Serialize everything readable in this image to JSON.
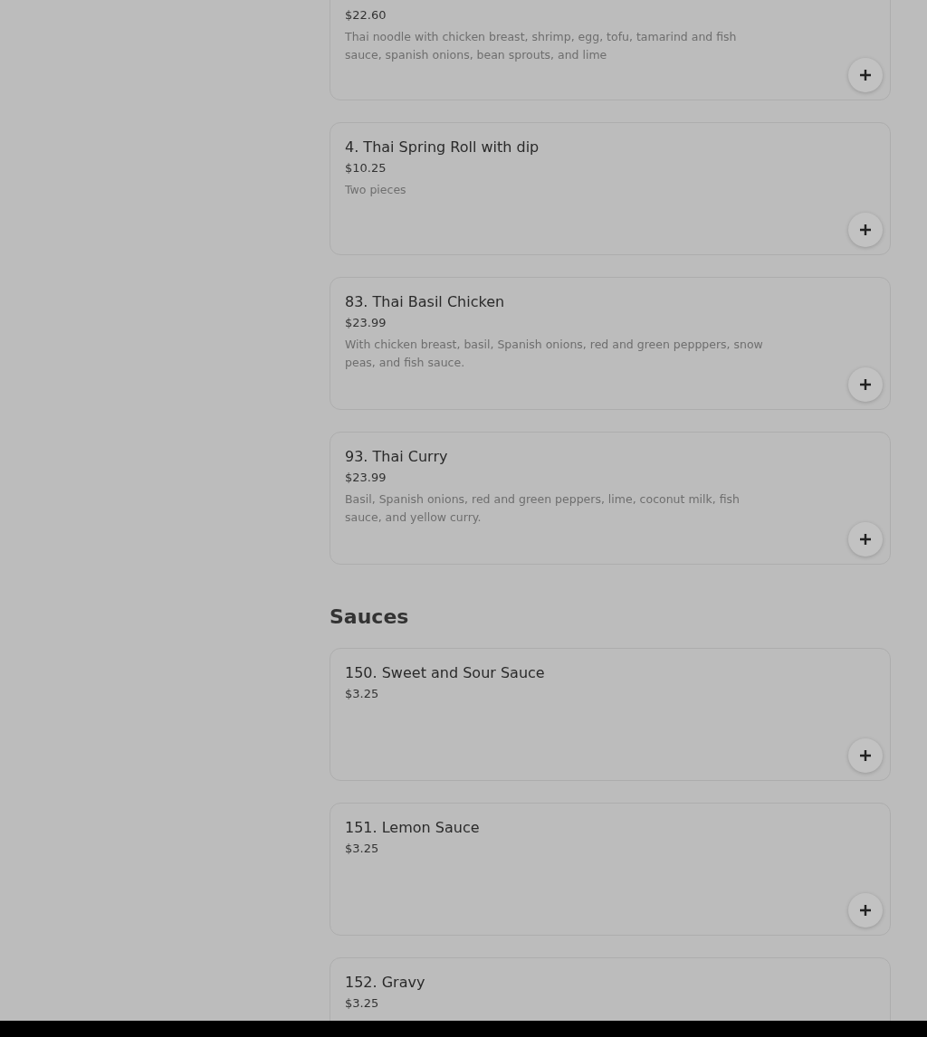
{
  "sections": [
    {
      "items": [
        {
          "price": "$22.60",
          "description": "Thai noodle with chicken breast, shrimp, egg, tofu, tamarind and fish sauce, spanish onions, bean sprouts, and lime"
        },
        {
          "name": "4. Thai Spring Roll with dip",
          "price": "$10.25",
          "description": "Two pieces"
        },
        {
          "name": "83. Thai Basil Chicken",
          "price": "$23.99",
          "description": "With chicken breast, basil, Spanish onions, red and green pepppers, snow peas, and fish sauce."
        },
        {
          "name": "93. Thai Curry",
          "price": "$23.99",
          "description": "Basil, Spanish onions, red and green peppers, lime, coconut milk, fish sauce, and yellow curry."
        }
      ]
    },
    {
      "title": "Sauces",
      "items": [
        {
          "name": "150. Sweet and Sour Sauce",
          "price": "$3.25"
        },
        {
          "name": "151. Lemon Sauce",
          "price": "$3.25"
        },
        {
          "name": "152. Gravy",
          "price": "$3.25",
          "cut_off": true
        }
      ]
    }
  ]
}
